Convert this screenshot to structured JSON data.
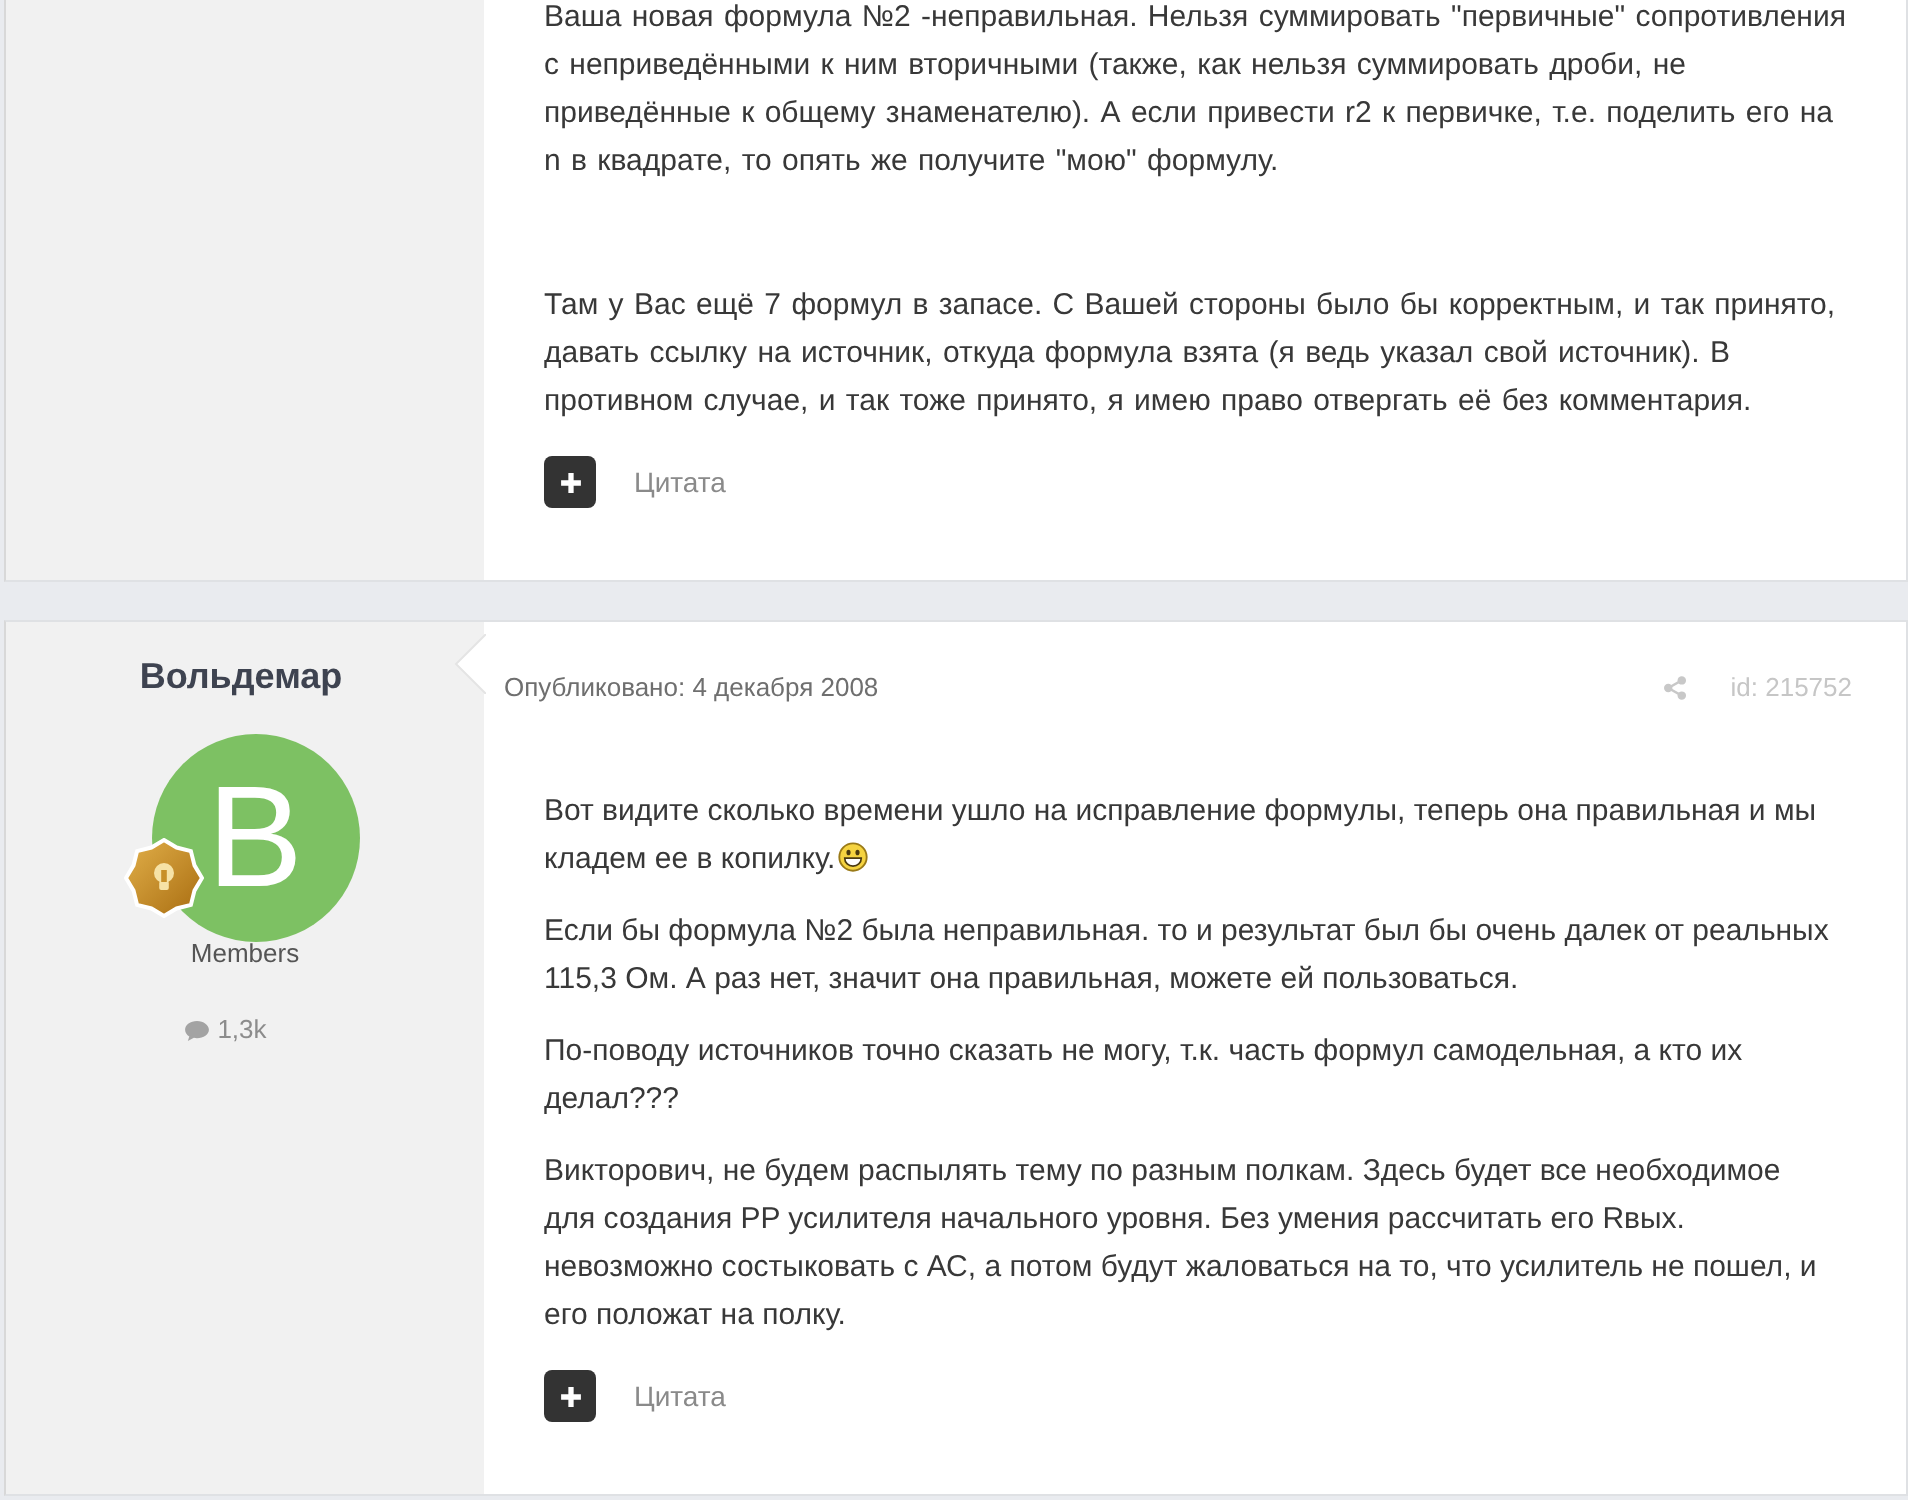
{
  "posts": [
    {
      "paragraphs": [
        {
          "text": "Ваша новая формула №2 -неправильная. Нельзя суммировать \"первичные\" сопротивления с неприведёнными к ним вторичными (также, как нельзя суммировать дроби, не приведённые к общему знаменателю). А если привести r2 к первичке, т.е. поделить его на n в квадрате, то опять же получите \"мою\" формулу.",
          "smiley": false
        },
        {
          "text": "Там у Вас ещё 7 формул в запасе. С Вашей стороны было бы корректным, и так принято, давать ссылку на источник, откуда формула взята (я ведь указал свой источник). В противном случае, и так тоже принято, я имею право отвергать её без комментария.",
          "smiley": false
        }
      ],
      "quote_label": "Цитата"
    },
    {
      "author": {
        "name": "Вольдемар",
        "avatar_letter": "В",
        "rank": "Members",
        "posts_count": "1,3k"
      },
      "published": "Опубликовано: 4 декабря 2008",
      "post_id": "id: 215752",
      "paragraphs": [
        {
          "text": "Вот видите сколько времени ушло на исправление формулы, теперь она правильная и мы кладем ее в копилку.",
          "smiley": true
        },
        {
          "text": "Если бы формула №2 была неправильная. то и результат был бы очень далек от реальных 115,3 Ом. А раз нет, значит она правильная, можете ей пользоваться.",
          "smiley": false
        },
        {
          "text": "По-поводу источников точно сказать не могу, т.к. часть формул самодельная, а кто их делал???",
          "smiley": false
        },
        {
          "text": "Викторович, не будем распылять тему по разным полкам. Здесь будет все необходимое для создания PP усилителя начального уровня. Без умения рассчитать его Rвых. невозможно состыковать с АС, а потом будут жаловаться на то, что усилитель не пошел, и его положат на полку.",
          "smiley": false
        }
      ],
      "quote_label": "Цитата"
    }
  ]
}
